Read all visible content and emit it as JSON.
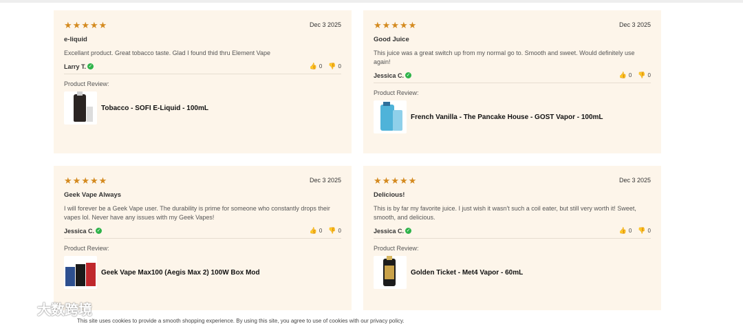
{
  "reviews": [
    {
      "stars": 5,
      "date": "Dec 3 2025",
      "title": "e-liquid",
      "body": "Excellant product. Great tobacco taste. Glad I found thid thru Element Vape",
      "author": "Larry T.",
      "helpful": "0",
      "unhelpful": "0",
      "product_label": "Product Review:",
      "product_name": "Tobacco - SOFI E-Liquid - 100mL",
      "thumb_color": "#2a2422"
    },
    {
      "stars": 5,
      "date": "Dec 3 2025",
      "title": "Good Juice",
      "body": "This juice was a great switch up from my normal go to. Smooth and sweet. Would definitely use again!",
      "author": "Jessica C.",
      "helpful": "0",
      "unhelpful": "0",
      "product_label": "Product Review:",
      "product_name": "French Vanilla - The Pancake House - GOST Vapor - 100mL",
      "thumb_color": "#4fb3d9"
    },
    {
      "stars": 5,
      "date": "Dec 3 2025",
      "title": "Geek Vape Always",
      "body": "I will forever be a Geek Vape user. The durability is prime for someone who constantly drops their vapes lol. Never have any issues with my Geek Vapes!",
      "author": "Jessica C.",
      "helpful": "0",
      "unhelpful": "0",
      "product_label": "Product Review:",
      "product_name": "Geek Vape Max100 (Aegis Max 2) 100W Box Mod",
      "thumb_color": "#c0282d"
    },
    {
      "stars": 5,
      "date": "Dec 3 2025",
      "title": "Delicious!",
      "body": "This is by far my favorite juice. I just wish it wasn't such a coil eater, but still very worth it! Sweet, smooth, and delicious.",
      "author": "Jessica C.",
      "helpful": "0",
      "unhelpful": "0",
      "product_label": "Product Review:",
      "product_name": "Golden Ticket - Met4 Vapor - 60mL",
      "thumb_color": "#1c1c1c"
    }
  ],
  "footer_notice": "This site uses cookies to provide a smooth shopping experience. By using this site, you agree to use of cookies with our privacy policy.",
  "watermark": "大数跨境",
  "accent_color": "#d48a1f",
  "card_bg": "#fdf5ea"
}
